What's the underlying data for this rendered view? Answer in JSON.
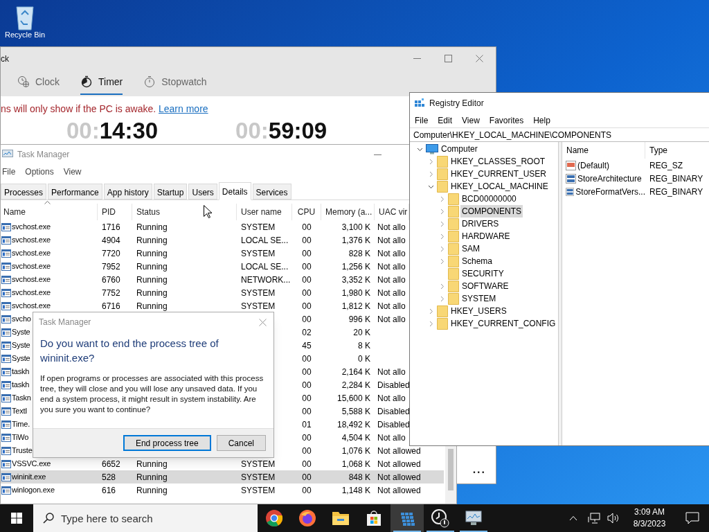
{
  "desktop": {
    "icons": [
      {
        "label": "Recycle Bin"
      }
    ]
  },
  "clock_window": {
    "title": "ck",
    "tabs": [
      {
        "label": "Clock",
        "kind": "clock",
        "selected": false
      },
      {
        "label": "Timer",
        "kind": "timer",
        "selected": true
      },
      {
        "label": "Stopwatch",
        "kind": "stopwatch",
        "selected": false
      }
    ],
    "notice": "ns will only show if the PC is awake.",
    "notice_link": "Learn more",
    "timers": [
      {
        "dim": "00:",
        "value": "14:30"
      },
      {
        "dim": "00:",
        "value": "59:09"
      }
    ],
    "more": "..."
  },
  "task_manager": {
    "title": "Task Manager",
    "menu": [
      "File",
      "Options",
      "View"
    ],
    "tabs": [
      {
        "label": "Processes",
        "selected": false
      },
      {
        "label": "Performance",
        "selected": false
      },
      {
        "label": "App history",
        "selected": false
      },
      {
        "label": "Startup",
        "selected": false
      },
      {
        "label": "Users",
        "selected": false
      },
      {
        "label": "Details",
        "selected": true
      },
      {
        "label": "Services",
        "selected": false
      }
    ],
    "columns": [
      "Name",
      "PID",
      "Status",
      "User name",
      "CPU",
      "Memory (a...",
      "UAC vir"
    ],
    "rows": [
      {
        "selected": false,
        "name": "svchost.exe",
        "pid": "1716",
        "status": "Running",
        "user": "SYSTEM",
        "cpu": "00",
        "memory": "3,100 K",
        "uac": "Not allo"
      },
      {
        "selected": false,
        "name": "svchost.exe",
        "pid": "4904",
        "status": "Running",
        "user": "LOCAL SE...",
        "cpu": "00",
        "memory": "1,376 K",
        "uac": "Not allo"
      },
      {
        "selected": false,
        "name": "svchost.exe",
        "pid": "7720",
        "status": "Running",
        "user": "SYSTEM",
        "cpu": "00",
        "memory": "828 K",
        "uac": "Not allo"
      },
      {
        "selected": false,
        "name": "svchost.exe",
        "pid": "7952",
        "status": "Running",
        "user": "LOCAL SE...",
        "cpu": "00",
        "memory": "1,256 K",
        "uac": "Not allo"
      },
      {
        "selected": false,
        "name": "svchost.exe",
        "pid": "6760",
        "status": "Running",
        "user": "NETWORK...",
        "cpu": "00",
        "memory": "3,352 K",
        "uac": "Not allo"
      },
      {
        "selected": false,
        "name": "svchost.exe",
        "pid": "7752",
        "status": "Running",
        "user": "SYSTEM",
        "cpu": "00",
        "memory": "1,980 K",
        "uac": "Not allo"
      },
      {
        "selected": false,
        "name": "svchost.exe",
        "pid": "6716",
        "status": "Running",
        "user": "SYSTEM",
        "cpu": "00",
        "memory": "1,812 K",
        "uac": "Not allo"
      },
      {
        "selected": false,
        "name": "svcho",
        "cpu": "00",
        "memory": "996 K",
        "uac": "Not allo"
      },
      {
        "selected": false,
        "name": "Syste",
        "cpu": "02",
        "memory": "20 K"
      },
      {
        "selected": false,
        "name": "Syste",
        "cpu": "45",
        "memory": "8 K"
      },
      {
        "selected": false,
        "name": "Syste",
        "cpu": "00",
        "memory": "0 K"
      },
      {
        "selected": false,
        "name": "taskh",
        "cpu": "00",
        "memory": "2,164 K",
        "uac": "Not allo"
      },
      {
        "selected": false,
        "name": "taskh",
        "cpu": "00",
        "memory": "2,284 K",
        "uac": "Disabled"
      },
      {
        "selected": false,
        "name": "Taskn",
        "cpu": "00",
        "memory": "15,600 K",
        "uac": "Not allo"
      },
      {
        "selected": false,
        "name": "TextI",
        "cpu": "00",
        "memory": "5,588 K",
        "uac": "Disabled"
      },
      {
        "selected": false,
        "name": "Time.",
        "cpu": "01",
        "memory": "18,492 K",
        "uac": "Disabled"
      },
      {
        "selected": false,
        "name": "TiWo",
        "cpu": "00",
        "memory": "4,504 K",
        "uac": "Not allo"
      },
      {
        "selected": false,
        "name": "Truste",
        "cpu": "00",
        "memory": "1,076 K",
        "uac": "Not allowed"
      },
      {
        "selected": false,
        "name": "VSSVC.exe",
        "pid": "6652",
        "status": "Running",
        "user": "SYSTEM",
        "cpu": "00",
        "memory": "1,068 K",
        "uac": "Not allowed"
      },
      {
        "selected": true,
        "name": "wininit.exe",
        "pid": "528",
        "status": "Running",
        "user": "SYSTEM",
        "cpu": "00",
        "memory": "848 K",
        "uac": "Not allowed"
      },
      {
        "selected": false,
        "name": "winlogon.exe",
        "pid": "616",
        "status": "Running",
        "user": "SYSTEM",
        "cpu": "00",
        "memory": "1,148 K",
        "uac": "Not allowed"
      }
    ]
  },
  "dialog": {
    "title": "Task Manager",
    "heading": "Do you want to end the process tree of wininit.exe?",
    "body": "If open programs or processes are associated with this process tree, they will close and you will lose any unsaved data. If you end a system process, it might result in system instability. Are you sure you want to continue?",
    "buttons": [
      {
        "label": "End process tree",
        "default": true
      },
      {
        "label": "Cancel",
        "default": false
      }
    ]
  },
  "registry": {
    "title": "Registry Editor",
    "menu": [
      "File",
      "Edit",
      "View",
      "Favorites",
      "Help"
    ],
    "address": "Computer\\HKEY_LOCAL_MACHINE\\COMPONENTS",
    "tree": [
      {
        "label": "Computer",
        "kind": "computer",
        "expandable": true,
        "expanded": true,
        "selected": false,
        "children": [
          {
            "label": "HKEY_CLASSES_ROOT",
            "kind": "folder",
            "expandable": true,
            "expanded": false,
            "selected": false
          },
          {
            "label": "HKEY_CURRENT_USER",
            "kind": "folder",
            "expandable": true,
            "expanded": false,
            "selected": false
          },
          {
            "label": "HKEY_LOCAL_MACHINE",
            "kind": "folder",
            "expandable": true,
            "expanded": true,
            "selected": false,
            "children": [
              {
                "label": "BCD00000000",
                "kind": "folder",
                "expandable": true,
                "expanded": false,
                "selected": false
              },
              {
                "label": "COMPONENTS",
                "kind": "folder",
                "expandable": true,
                "expanded": false,
                "selected": true
              },
              {
                "label": "DRIVERS",
                "kind": "folder",
                "expandable": true,
                "expanded": false,
                "selected": false
              },
              {
                "label": "HARDWARE",
                "kind": "folder",
                "expandable": true,
                "expanded": false,
                "selected": false
              },
              {
                "label": "SAM",
                "kind": "folder",
                "expandable": true,
                "expanded": false,
                "selected": false
              },
              {
                "label": "Schema",
                "kind": "folder",
                "expandable": true,
                "expanded": false,
                "selected": false
              },
              {
                "label": "SECURITY",
                "kind": "folder",
                "expandable": false,
                "expanded": false,
                "selected": false
              },
              {
                "label": "SOFTWARE",
                "kind": "folder",
                "expandable": true,
                "expanded": false,
                "selected": false
              },
              {
                "label": "SYSTEM",
                "kind": "folder",
                "expandable": true,
                "expanded": false,
                "selected": false
              }
            ]
          },
          {
            "label": "HKEY_USERS",
            "kind": "folder",
            "expandable": true,
            "expanded": false,
            "selected": false
          },
          {
            "label": "HKEY_CURRENT_CONFIG",
            "kind": "folder",
            "expandable": true,
            "expanded": false,
            "selected": false
          }
        ]
      }
    ],
    "columns": [
      "Name",
      "Type"
    ],
    "values": [
      {
        "kind": "string",
        "name": "(Default)",
        "type": "REG_SZ"
      },
      {
        "kind": "binary",
        "name": "StoreArchitecture",
        "type": "REG_BINARY"
      },
      {
        "kind": "binary",
        "name": "StoreFormatVers...",
        "type": "REG_BINARY"
      }
    ]
  },
  "taskbar": {
    "search_placeholder": "Type here to search",
    "apps": [
      {
        "kind": "chrome",
        "active": false,
        "running": false
      },
      {
        "kind": "firefox",
        "active": false,
        "running": false
      },
      {
        "kind": "explorer",
        "active": false,
        "running": false
      },
      {
        "kind": "store",
        "active": false,
        "running": false
      },
      {
        "kind": "regedit",
        "active": true,
        "running": true
      },
      {
        "kind": "alarms",
        "active": false,
        "running": true
      },
      {
        "kind": "taskmgr",
        "active": false,
        "running": true
      }
    ],
    "time": "3:09 AM",
    "date": "8/3/2023"
  }
}
